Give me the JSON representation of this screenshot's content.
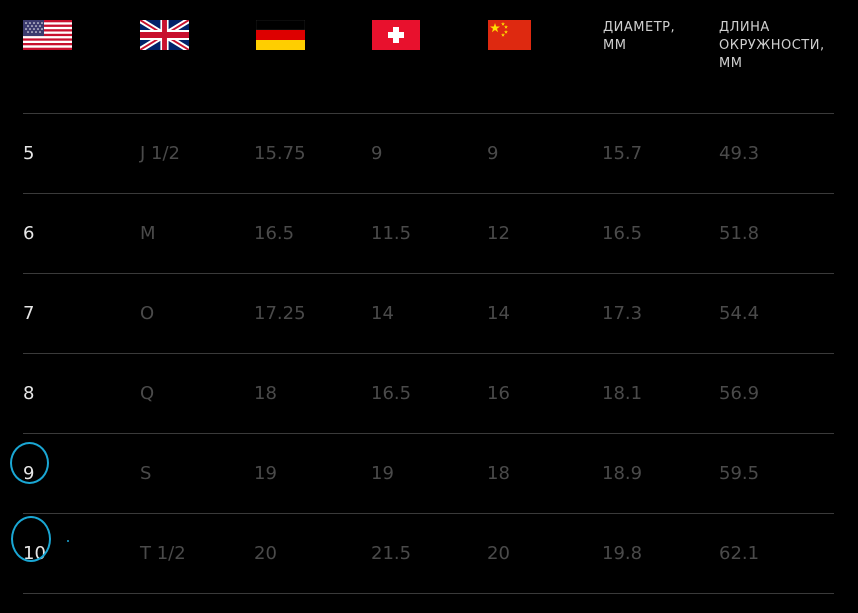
{
  "header": {
    "flags": [
      {
        "icon": "us-flag-icon",
        "country": "USA"
      },
      {
        "icon": "uk-flag-icon",
        "country": "UK"
      },
      {
        "icon": "germany-flag-icon",
        "country": "Germany"
      },
      {
        "icon": "switzerland-flag-icon",
        "country": "Switzerland"
      },
      {
        "icon": "china-flag-icon",
        "country": "China"
      }
    ],
    "diameter_label_line1": "ДИАМЕТР,",
    "diameter_label_line2": "ММ",
    "circumference_label_line1": "ДЛИНА",
    "circumference_label_line2": "ОКРУЖНОСТИ,",
    "circumference_label_line3": "ММ"
  },
  "rows": [
    {
      "us": "5",
      "uk": "J 1/2",
      "de": "15.75",
      "ch": "9",
      "cn": "9",
      "diameter": "15.7",
      "circumference": "49.3"
    },
    {
      "us": "6",
      "uk": "M",
      "de": "16.5",
      "ch": "11.5",
      "cn": "12",
      "diameter": "16.5",
      "circumference": "51.8"
    },
    {
      "us": "7",
      "uk": "O",
      "de": "17.25",
      "ch": "14",
      "cn": "14",
      "diameter": "17.3",
      "circumference": "54.4"
    },
    {
      "us": "8",
      "uk": "Q",
      "de": "18",
      "ch": "16.5",
      "cn": "16",
      "diameter": "18.1",
      "circumference": "56.9"
    },
    {
      "us": "9",
      "uk": "S",
      "de": "19",
      "ch": "19",
      "cn": "18",
      "diameter": "18.9",
      "circumference": "59.5"
    },
    {
      "us": "10",
      "uk": "T 1/2",
      "de": "20",
      "ch": "21.5",
      "cn": "20",
      "diameter": "19.8",
      "circumference": "62.1"
    }
  ],
  "colors": {
    "background": "#000000",
    "us_text": "#e6e6e6",
    "dim_text": "#4a4a4a",
    "divider": "#3a3a3a",
    "annotation": "#1aa7d4"
  }
}
